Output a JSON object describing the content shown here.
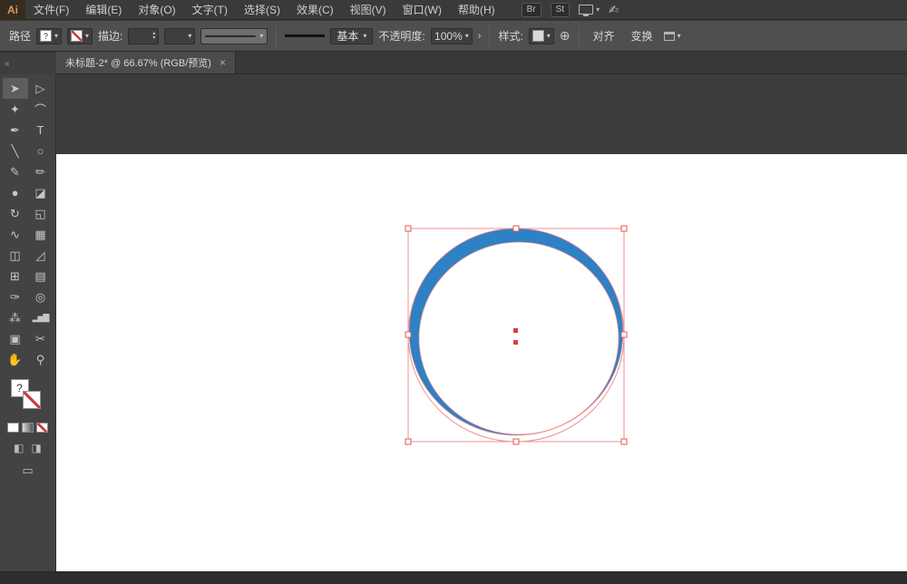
{
  "colors": {
    "accent_blue": "#2e81c4",
    "selection_red": "#e05555",
    "selection_light": "#ef9090",
    "center_red": "#e23b3b",
    "handle_fill": "#ffffff"
  },
  "menubar": {
    "logo": "Ai",
    "items": [
      "文件(F)",
      "编辑(E)",
      "对象(O)",
      "文字(T)",
      "选择(S)",
      "效果(C)",
      "视图(V)",
      "窗口(W)",
      "帮助(H)"
    ],
    "badge_br": "Br",
    "badge_st": "St"
  },
  "controlbar": {
    "context_label": "路径",
    "fill_swatch_mark": "?",
    "stroke_setting_label": "描边:",
    "brush_definition_label": "基本",
    "opacity_label": "不透明度:",
    "opacity_value": "100%",
    "style_label": "样式:",
    "align_label": "对齐",
    "transform_label": "变换"
  },
  "tabbar": {
    "document_tab_title": "未标题-2* @ 66.67% (RGB/预览)",
    "close_glyph": "×"
  },
  "icons": {
    "caret": "▾",
    "stepper_up": "▴",
    "stepper_down": "▾",
    "chevron_right": "›",
    "globe": "⊕",
    "signature": "✍",
    "collapse": "«",
    "draw_normal": "◧",
    "draw_behind": "◨",
    "screen_mode": "▭"
  },
  "toolbar": {
    "fill_swatch_mark": "?",
    "tools": [
      {
        "name": "selection-tool",
        "glyph": "➤",
        "selected": true
      },
      {
        "name": "direct-selection-tool",
        "glyph": "▷",
        "selected": false
      },
      {
        "name": "magic-wand-tool",
        "glyph": "✦",
        "selected": false
      },
      {
        "name": "lasso-tool",
        "glyph": "⌒",
        "selected": false
      },
      {
        "name": "pen-tool",
        "glyph": "✒",
        "selected": false
      },
      {
        "name": "type-tool",
        "glyph": "T",
        "selected": false
      },
      {
        "name": "line-segment-tool",
        "glyph": "╲",
        "selected": false
      },
      {
        "name": "ellipse-tool",
        "glyph": "○",
        "selected": false
      },
      {
        "name": "paintbrush-tool",
        "glyph": "✎",
        "selected": false
      },
      {
        "name": "pencil-tool",
        "glyph": "✏",
        "selected": false
      },
      {
        "name": "blob-brush-tool",
        "glyph": "●",
        "selected": false
      },
      {
        "name": "eraser-tool",
        "glyph": "◪",
        "selected": false
      },
      {
        "name": "rotate-tool",
        "glyph": "↻",
        "selected": false
      },
      {
        "name": "scale-tool",
        "glyph": "◱",
        "selected": false
      },
      {
        "name": "width-tool",
        "glyph": "∿",
        "selected": false
      },
      {
        "name": "free-transform-tool",
        "glyph": "▦",
        "selected": false
      },
      {
        "name": "shape-builder-tool",
        "glyph": "◫",
        "selected": false
      },
      {
        "name": "perspective-grid-tool",
        "glyph": "◿",
        "selected": false
      },
      {
        "name": "mesh-tool",
        "glyph": "⊞",
        "selected": false
      },
      {
        "name": "gradient-tool",
        "glyph": "▤",
        "selected": false
      },
      {
        "name": "eyedropper-tool",
        "glyph": "✑",
        "selected": false
      },
      {
        "name": "blend-tool",
        "glyph": "◎",
        "selected": false
      },
      {
        "name": "symbol-sprayer-tool",
        "glyph": "⁂",
        "selected": false
      },
      {
        "name": "column-graph-tool",
        "glyph": "▂▅▇",
        "selected": false,
        "small": true
      },
      {
        "name": "artboard-tool",
        "glyph": "▣",
        "selected": false
      },
      {
        "name": "slice-tool",
        "glyph": "✂",
        "selected": false
      },
      {
        "name": "hand-tool",
        "glyph": "✋",
        "selected": false
      },
      {
        "name": "zoom-tool",
        "glyph": "⚲",
        "selected": false
      }
    ]
  }
}
